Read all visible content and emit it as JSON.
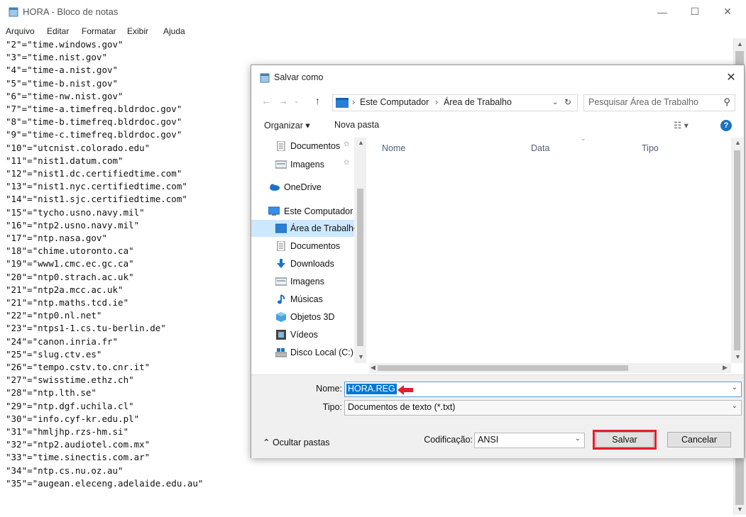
{
  "notepad": {
    "title": "HORA - Bloco de notas",
    "menu": [
      "Arquivo",
      "Editar",
      "Formatar",
      "Exibir",
      "Ajuda"
    ],
    "lines": [
      "\"2\"=\"time.windows.gov\"",
      "\"3\"=\"time.nist.gov\"",
      "\"4\"=\"time-a.nist.gov\"",
      "\"5\"=\"time-b.nist.gov\"",
      "\"6\"=\"time-nw.nist.gov\"",
      "\"7\"=\"time-a.timefreq.bldrdoc.gov\"",
      "\"8\"=\"time-b.timefreq.bldrdoc.gov\"",
      "\"9\"=\"time-c.timefreq.bldrdoc.gov\"",
      "\"10\"=\"utcnist.colorado.edu\"",
      "\"11\"=\"nist1.datum.com\"",
      "\"12\"=\"nist1.dc.certifiedtime.com\"",
      "\"13\"=\"nist1.nyc.certifiedtime.com\"",
      "\"14\"=\"nist1.sjc.certifiedtime.com\"",
      "\"15\"=\"tycho.usno.navy.mil\"",
      "\"16\"=\"ntp2.usno.navy.mil\"",
      "\"17\"=\"ntp.nasa.gov\"",
      "\"18\"=\"chime.utoronto.ca\"",
      "\"19\"=\"www1.cmc.ec.gc.ca\"",
      "\"20\"=\"ntp0.strach.ac.uk\"",
      "\"21\"=\"ntp2a.mcc.ac.uk\"",
      "\"21\"=\"ntp.maths.tcd.ie\"",
      "\"22\"=\"ntp0.nl.net\"",
      "\"23\"=\"ntps1-1.cs.tu-berlin.de\"",
      "\"24\"=\"canon.inria.fr\"",
      "\"25\"=\"slug.ctv.es\"",
      "\"26\"=\"tempo.cstv.to.cnr.it\"",
      "\"27\"=\"swisstime.ethz.ch\"",
      "\"28\"=\"ntp.lth.se\"",
      "\"29\"=\"ntp.dgf.uchila.cl\"",
      "\"30\"=\"info.cyf-kr.edu.pl\"",
      "\"31\"=\"hmljhp.rzs-hm.si\"",
      "\"32\"=\"ntp2.audiotel.com.mx\"",
      "\"33\"=\"time.sinectis.com.ar\"",
      "\"34\"=\"ntp.cs.nu.oz.au\"",
      "\"35\"=\"augean.eleceng.adelaide.edu.au\""
    ]
  },
  "dialog": {
    "title": "Salvar como",
    "breadcrumb": [
      "Este Computador",
      "Área de Trabalho"
    ],
    "search_placeholder": "Pesquisar Área de Trabalho",
    "organize": "Organizar ▾",
    "new_folder": "Nova pasta",
    "nav_items": [
      {
        "label": "Documentos",
        "icon": "document-icon",
        "pinned": true
      },
      {
        "label": "Imagens",
        "icon": "pictures-icon",
        "pinned": true
      },
      {
        "label": "OneDrive",
        "icon": "cloud-icon",
        "pinned": false
      },
      {
        "label": "Este Computador",
        "icon": "computer-icon",
        "pinned": false
      },
      {
        "label": "Área de Trabalho",
        "icon": "desktop-icon",
        "pinned": false,
        "selected": true
      },
      {
        "label": "Documentos",
        "icon": "document-icon",
        "pinned": false
      },
      {
        "label": "Downloads",
        "icon": "download-icon",
        "pinned": false
      },
      {
        "label": "Imagens",
        "icon": "pictures-icon",
        "pinned": false
      },
      {
        "label": "Músicas",
        "icon": "music-icon",
        "pinned": false
      },
      {
        "label": "Objetos 3D",
        "icon": "cube-icon",
        "pinned": false
      },
      {
        "label": "Vídeos",
        "icon": "video-icon",
        "pinned": false
      },
      {
        "label": "Disco Local (C:)",
        "icon": "drive-icon",
        "pinned": false
      }
    ],
    "columns": [
      "Nome",
      "Data",
      "Tipo"
    ],
    "name_label": "Nome:",
    "file_name": "HORA.REG",
    "type_label": "Tipo:",
    "file_type": "Documentos de texto (*.txt)",
    "encoding_label": "Codificação:",
    "encoding": "ANSI",
    "hide_folders": "Ocultar pastas",
    "save": "Salvar",
    "cancel": "Cancelar"
  },
  "colors": {
    "accent": "#0078d7",
    "highlight": "#e31e2d",
    "selected_nav": "#cce8ff"
  }
}
